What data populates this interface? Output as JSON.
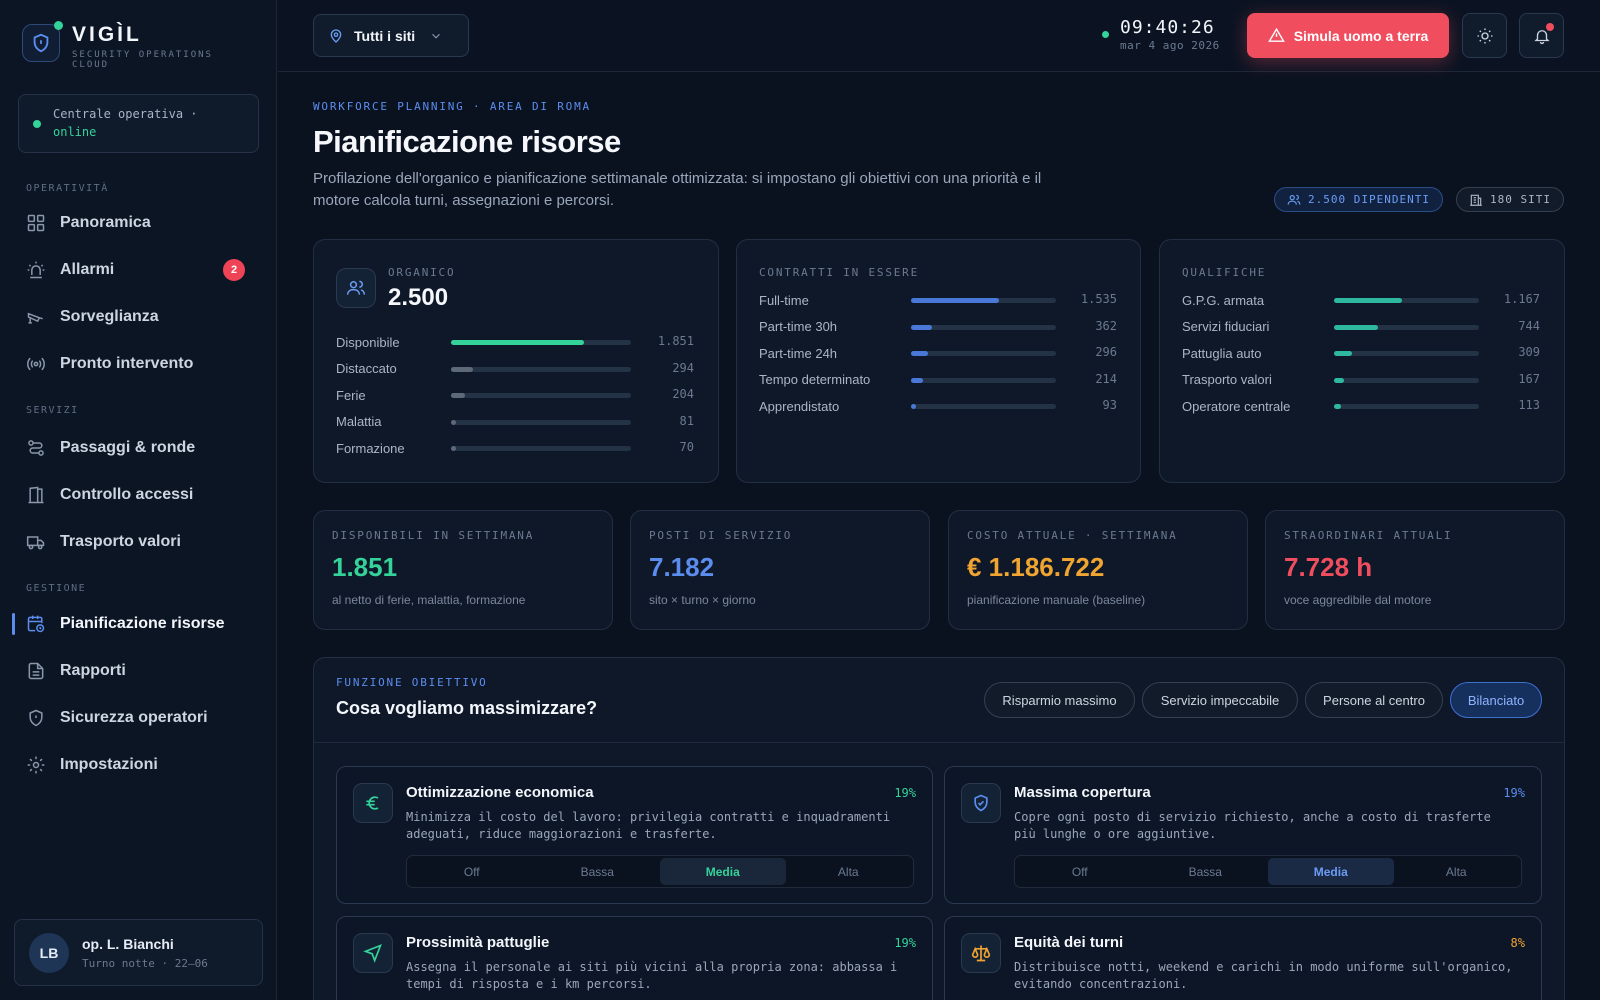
{
  "brand": {
    "name": "VIGÌL",
    "subtitle": "SECURITY OPERATIONS CLOUD"
  },
  "status": {
    "text": "Centrale operativa ·",
    "state": "online"
  },
  "nav": {
    "sections": [
      "OPERATIVITÀ",
      "SERVIZI",
      "GESTIONE"
    ],
    "items": [
      {
        "label": "Panoramica",
        "icon": "grid-icon"
      },
      {
        "label": "Allarmi",
        "icon": "siren-icon",
        "badge": "2"
      },
      {
        "label": "Sorveglianza",
        "icon": "camera-icon"
      },
      {
        "label": "Pronto intervento",
        "icon": "broadcast-icon"
      },
      {
        "label": "Passaggi & ronde",
        "icon": "route-icon"
      },
      {
        "label": "Controllo accessi",
        "icon": "door-icon"
      },
      {
        "label": "Trasporto valori",
        "icon": "truck-icon"
      },
      {
        "label": "Pianificazione risorse",
        "icon": "calendar-clock-icon",
        "active": true
      },
      {
        "label": "Rapporti",
        "icon": "document-icon"
      },
      {
        "label": "Sicurezza operatori",
        "icon": "shield-icon"
      },
      {
        "label": "Impostazioni",
        "icon": "gear-icon"
      }
    ]
  },
  "user": {
    "initials": "LB",
    "name": "op. L. Bianchi",
    "shift": "Turno notte · 22–06"
  },
  "topbar": {
    "site_select": "Tutti i siti",
    "time": "09:40:26",
    "date": "mar 4 ago 2026",
    "sim_button": "Simula uomo a terra"
  },
  "header": {
    "eyebrow": "WORKFORCE PLANNING · AREA DI ROMA",
    "title": "Pianificazione risorse",
    "description": "Profilazione dell'organico e pianificazione settimanale ottimizzata: si impostano gli obiettivi con una priorità e il motore calcola turni, assegnazioni e percorsi.",
    "chip_employees": "2.500 DIPENDENTI",
    "chip_sites": "180 SITI"
  },
  "organico": {
    "label": "ORGANICO",
    "total": "2.500",
    "rows": [
      {
        "label": "Disponibile",
        "value": "1.851",
        "fraction": 0.74,
        "color": "#34d399"
      },
      {
        "label": "Distaccato",
        "value": "294",
        "fraction": 0.12,
        "color": "#5d6878"
      },
      {
        "label": "Ferie",
        "value": "204",
        "fraction": 0.08,
        "color": "#5d6878"
      },
      {
        "label": "Malattia",
        "value": "81",
        "fraction": 0.03,
        "color": "#5d6878"
      },
      {
        "label": "Formazione",
        "value": "70",
        "fraction": 0.028,
        "color": "#5d6878"
      }
    ]
  },
  "contratti": {
    "label": "CONTRATTI IN ESSERE",
    "rows": [
      {
        "label": "Full-time",
        "value": "1.535",
        "fraction": 0.61,
        "color": "#4a78d8"
      },
      {
        "label": "Part-time 30h",
        "value": "362",
        "fraction": 0.145,
        "color": "#4a78d8"
      },
      {
        "label": "Part-time 24h",
        "value": "296",
        "fraction": 0.118,
        "color": "#4a78d8"
      },
      {
        "label": "Tempo determinato",
        "value": "214",
        "fraction": 0.086,
        "color": "#4a78d8"
      },
      {
        "label": "Apprendistato",
        "value": "93",
        "fraction": 0.037,
        "color": "#4a78d8"
      }
    ]
  },
  "qualifiche": {
    "label": "QUALIFICHE",
    "rows": [
      {
        "label": "G.P.G. armata",
        "value": "1.167",
        "fraction": 0.47,
        "color": "#2fb8a0"
      },
      {
        "label": "Servizi fiduciari",
        "value": "744",
        "fraction": 0.3,
        "color": "#2fb8a0"
      },
      {
        "label": "Pattuglia auto",
        "value": "309",
        "fraction": 0.124,
        "color": "#2fb8a0"
      },
      {
        "label": "Trasporto valori",
        "value": "167",
        "fraction": 0.067,
        "color": "#2fb8a0"
      },
      {
        "label": "Operatore centrale",
        "value": "113",
        "fraction": 0.045,
        "color": "#2fb8a0"
      }
    ]
  },
  "kpis": [
    {
      "label": "DISPONIBILI IN SETTIMANA",
      "value": "1.851",
      "sub": "al netto di ferie, malattia, formazione",
      "color": "#34d399"
    },
    {
      "label": "POSTI DI SERVIZIO",
      "value": "7.182",
      "sub": "sito × turno × giorno",
      "color": "#5b8def"
    },
    {
      "label": "COSTO ATTUALE · SETTIMANA",
      "value": "€ 1.186.722",
      "sub": "pianificazione manuale (baseline)",
      "color": "#f0a431"
    },
    {
      "label": "STRAORDINARI ATTUALI",
      "value": "7.728 h",
      "sub": "voce aggredibile dal motore",
      "color": "#f04e5f"
    }
  ],
  "objective": {
    "eyebrow": "FUNZIONE OBIETTIVO",
    "title": "Cosa vogliamo massimizzare?",
    "presets": [
      "Risparmio massimo",
      "Servizio impeccabile",
      "Persone al centro",
      "Bilanciato"
    ],
    "selected_preset": "Bilanciato",
    "levels": [
      "Off",
      "Bassa",
      "Media",
      "Alta"
    ],
    "goals": [
      {
        "title": "Ottimizzazione economica",
        "pct": "19%",
        "desc": "Minimizza il costo del lavoro: privilegia contratti e inquadramenti adeguati, riduce maggiorazioni e trasferte.",
        "level": "Media",
        "icon": "euro-icon",
        "color": "#34d399"
      },
      {
        "title": "Massima copertura",
        "pct": "19%",
        "desc": "Copre ogni posto di servizio richiesto, anche a costo di trasferte più lunghe o ore aggiuntive.",
        "level": "Media",
        "icon": "shield-check-icon",
        "color": "#5b8def"
      },
      {
        "title": "Prossimità pattuglie",
        "pct": "19%",
        "desc": "Assegna il personale ai siti più vicini alla propria zona: abbassa i tempi di risposta e i km percorsi.",
        "icon": "navigation-icon",
        "color": "#34d399"
      },
      {
        "title": "Equità dei turni",
        "pct": "8%",
        "desc": "Distribuisce notti, weekend e carichi in modo uniforme sull'organico, evitando concentrazioni.",
        "icon": "scale-icon",
        "color": "#f0a431"
      }
    ]
  }
}
